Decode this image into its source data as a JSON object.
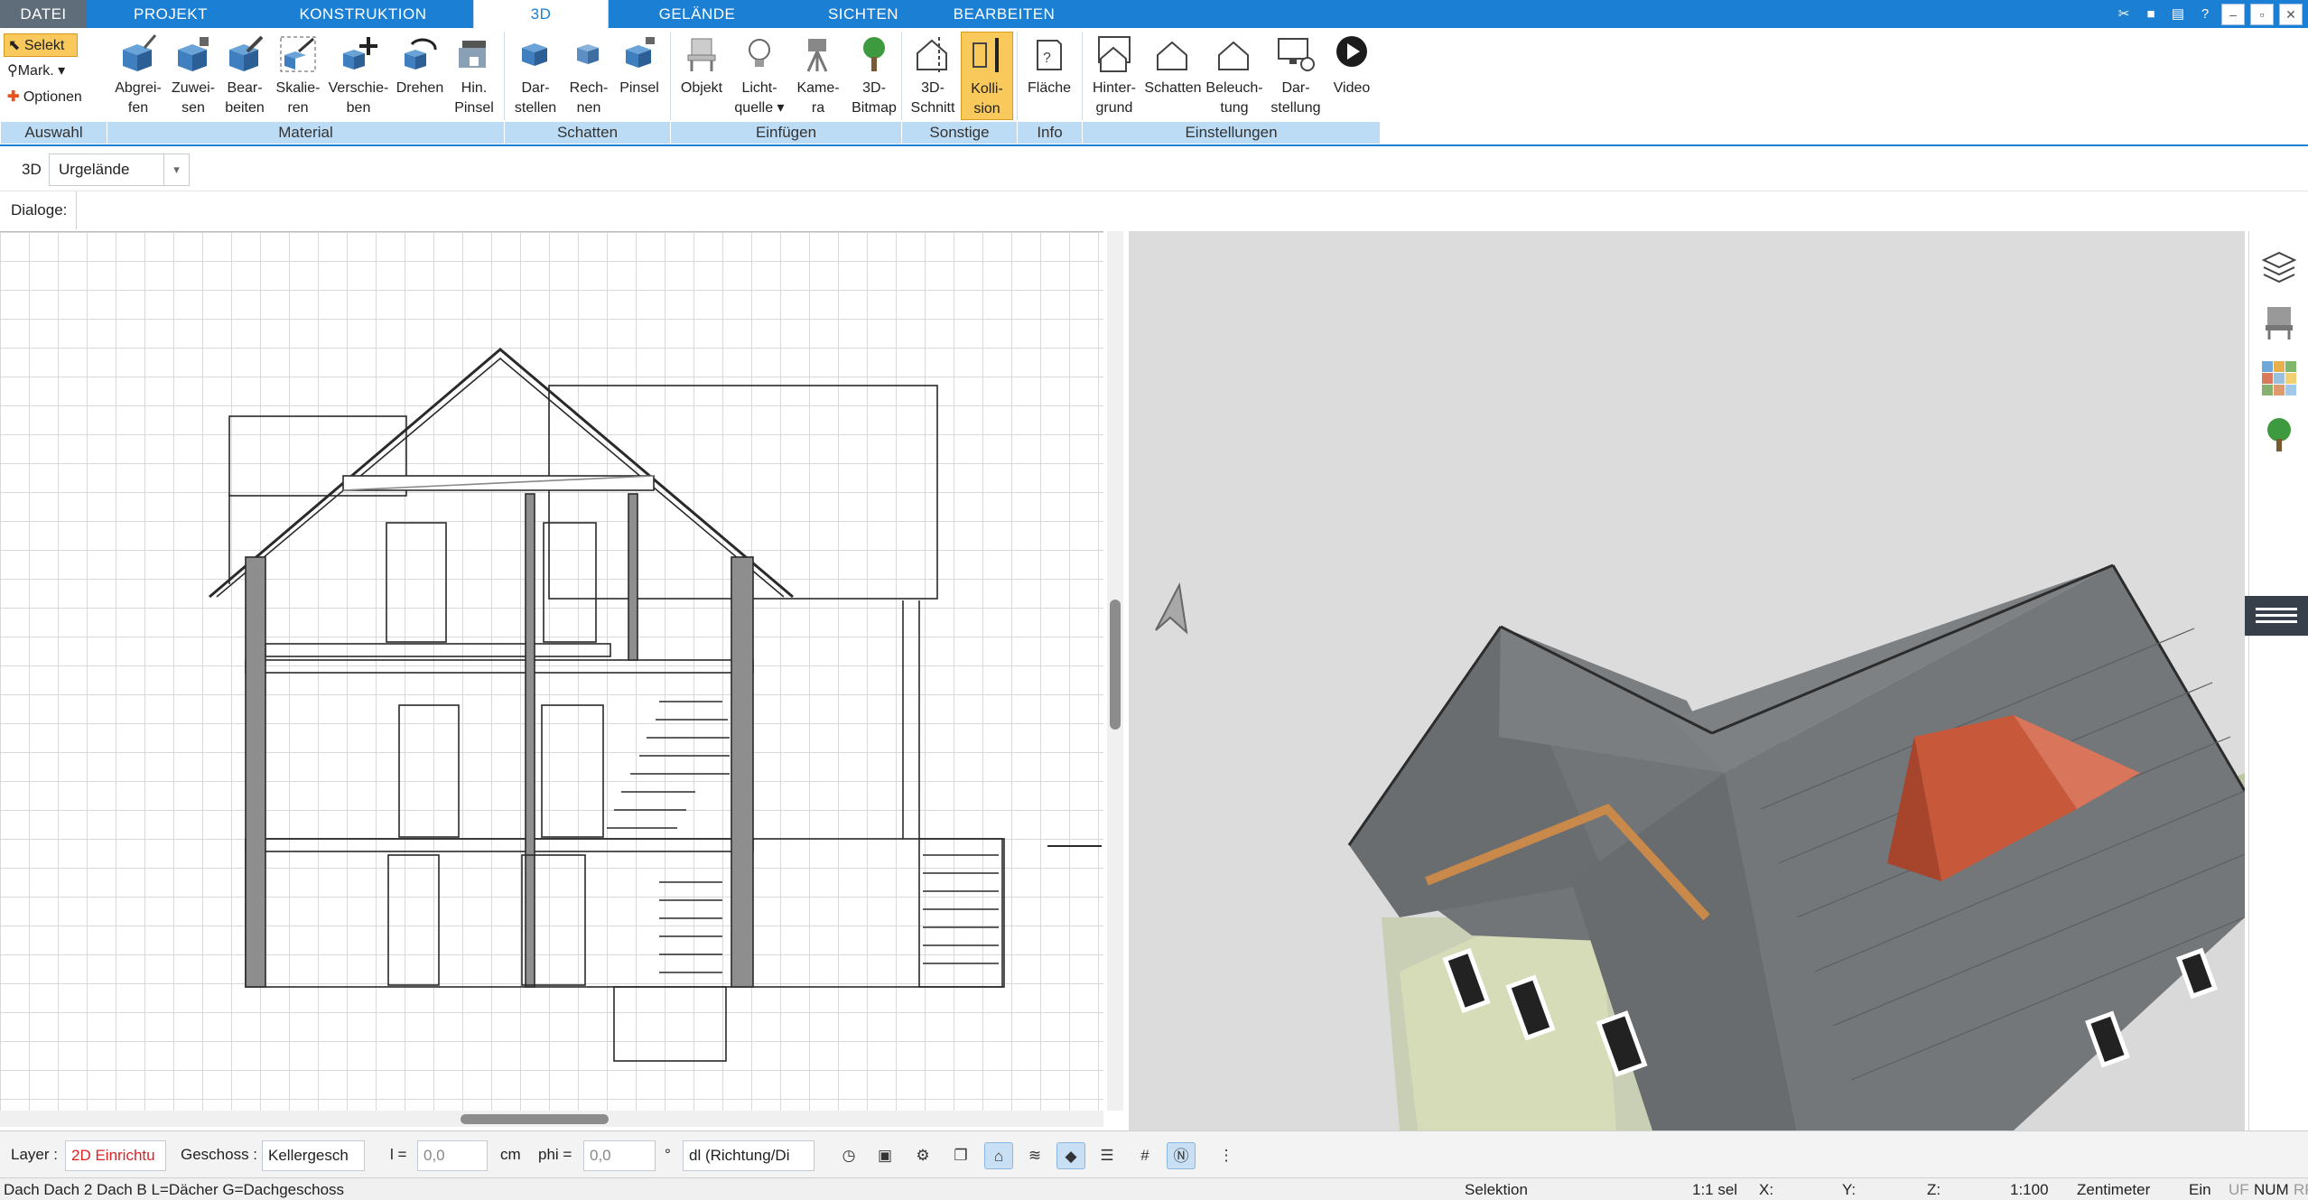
{
  "menu": {
    "file": "DATEI",
    "tabs": [
      "PROJEKT",
      "KONSTRUKTION",
      "3D",
      "GELÄNDE",
      "SICHTEN",
      "BEARBEITEN"
    ]
  },
  "ribbon": {
    "auswahl": {
      "selekt": "Selekt",
      "mark": "Mark.",
      "optionen": "Optionen",
      "group": "Auswahl"
    },
    "material": {
      "group": "Material",
      "buttons": [
        {
          "l1": "Abgrei-",
          "l2": "fen"
        },
        {
          "l1": "Zuwei-",
          "l2": "sen"
        },
        {
          "l1": "Bear-",
          "l2": "beiten"
        },
        {
          "l1": "Skalie-",
          "l2": "ren"
        },
        {
          "l1": "Verschie-",
          "l2": "ben"
        },
        {
          "l1": "Drehen",
          "l2": ""
        },
        {
          "l1": "Hin.",
          "l2": "Pinsel"
        }
      ]
    },
    "schatten": {
      "group": "Schatten",
      "buttons": [
        {
          "l1": "Dar-",
          "l2": "stellen"
        },
        {
          "l1": "Rech-",
          "l2": "nen"
        },
        {
          "l1": "Pinsel",
          "l2": ""
        }
      ]
    },
    "einfuegen": {
      "group": "Einfügen",
      "buttons": [
        {
          "l1": "Objekt",
          "l2": ""
        },
        {
          "l1": "Licht-",
          "l2": "quelle ▾"
        },
        {
          "l1": "Kame-",
          "l2": "ra"
        },
        {
          "l1": "3D-",
          "l2": "Bitmap"
        }
      ]
    },
    "sonstige": {
      "group": "Sonstige",
      "buttons": [
        {
          "l1": "3D-",
          "l2": "Schnitt"
        },
        {
          "l1": "Kolli-",
          "l2": "sion"
        }
      ]
    },
    "info": {
      "group": "Info",
      "buttons": [
        {
          "l1": "Fläche",
          "l2": ""
        }
      ]
    },
    "einstellungen": {
      "group": "Einstellungen",
      "buttons": [
        {
          "l1": "Hinter-",
          "l2": "grund"
        },
        {
          "l1": "Schatten",
          "l2": ""
        },
        {
          "l1": "Beleuch-",
          "l2": "tung"
        },
        {
          "l1": "Dar-",
          "l2": "stellung"
        },
        {
          "l1": "Video",
          "l2": ""
        }
      ]
    }
  },
  "toolbar": {
    "mode_label": "3D",
    "terrain_value": "Urgelände",
    "dialoge_label": "Dialoge:"
  },
  "bottombar": {
    "layer_label": "Layer :",
    "layer_value": "2D Einrichtu",
    "geschoss_label": "Geschoss :",
    "geschoss_value": "Kellergesch",
    "l_label": "l =",
    "l_value": "0,0",
    "l_unit": "cm",
    "phi_label": "phi =",
    "phi_value": "0,0",
    "phi_unit": "°",
    "dl_value": "dl (Richtung/Di"
  },
  "statusbar": {
    "info": "Dach Dach 2 Dach B L=Dächer G=Dachgeschoss",
    "mode": "Selektion",
    "sel": "1:1 sel",
    "x": "X:",
    "y": "Y:",
    "z": "Z:",
    "scale": "1:100",
    "unit": "Zentimeter",
    "ein": "Ein",
    "uf": "UF",
    "num": "NUM",
    "rf": "RF"
  },
  "colors": {
    "accent": "#1b7fd4",
    "ribbon_group_bg": "#bcdcf5",
    "active_button": "#f9c95c",
    "roof_gray": "#6f7274",
    "dormer_orange": "#c8583a"
  }
}
